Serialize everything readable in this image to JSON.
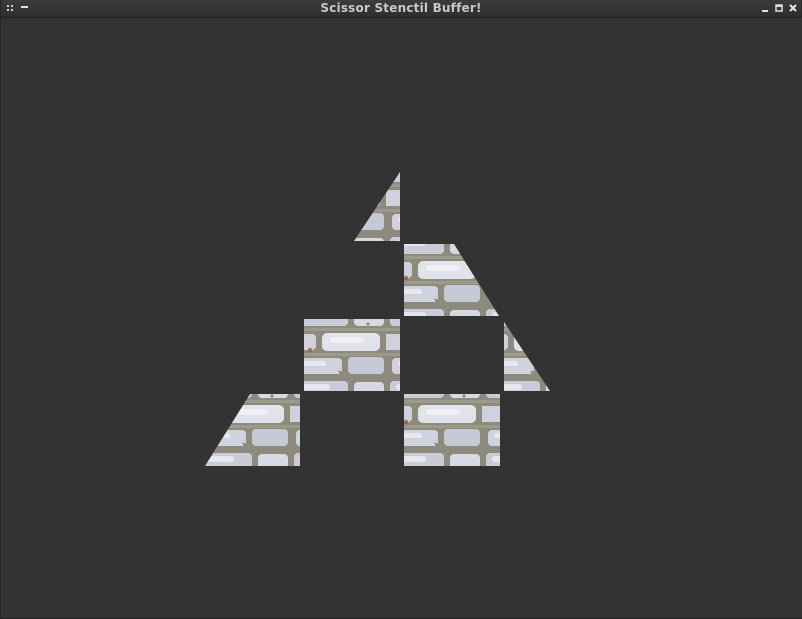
{
  "window": {
    "title": "Scissor Stenctil Buffer!"
  },
  "titlebar_buttons": [
    {
      "name": "window-menu-icon",
      "icon": "grip-dots"
    },
    {
      "name": "shade-icon",
      "icon": "dash"
    },
    {
      "name": "minimize-icon",
      "icon": "underscore"
    },
    {
      "name": "maximize-icon",
      "icon": "square"
    },
    {
      "name": "close-icon",
      "icon": "x"
    }
  ],
  "scene": {
    "background": "#333333",
    "texture": "stone-brick-wall",
    "texture_colors": {
      "mortar": "#8e8a7e",
      "stone": "#c9ccd6",
      "stone_light": "#e4e6ee",
      "stain": "#9c5a40"
    }
  }
}
